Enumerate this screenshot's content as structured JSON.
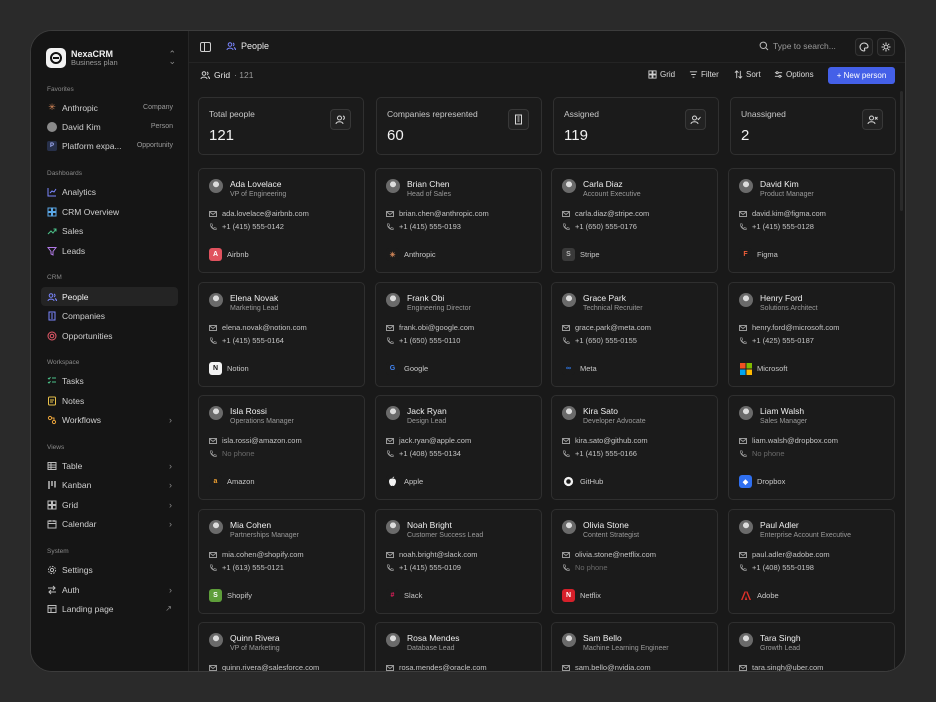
{
  "workspace": {
    "name": "NexaCRM",
    "plan": "Business plan"
  },
  "sidebar": {
    "favorites": {
      "label": "Favorites",
      "items": [
        {
          "label": "Anthropic",
          "meta": "Company"
        },
        {
          "label": "David Kim",
          "meta": "Person"
        },
        {
          "label": "Platform expa...",
          "meta": "Opportunity"
        }
      ]
    },
    "dashboards": {
      "label": "Dashboards",
      "items": [
        "Analytics",
        "CRM Overview",
        "Sales",
        "Leads"
      ]
    },
    "crm": {
      "label": "CRM",
      "items": [
        "People",
        "Companies",
        "Opportunities"
      ]
    },
    "workspace": {
      "label": "Workspace",
      "items": [
        "Tasks",
        "Notes",
        "Workflows"
      ]
    },
    "views": {
      "label": "Views",
      "items": [
        "Table",
        "Kanban",
        "Grid",
        "Calendar"
      ]
    },
    "system": {
      "label": "System",
      "items": [
        "Settings",
        "Auth",
        "Landing page"
      ]
    }
  },
  "topbar": {
    "breadcrumb": "People",
    "search_placeholder": "Type to search..."
  },
  "toolbar": {
    "view": "Grid",
    "count": "· 121",
    "grid": "Grid",
    "filter": "Filter",
    "sort": "Sort",
    "options": "Options",
    "new_person": "+ New person"
  },
  "stats": [
    {
      "label": "Total people",
      "value": "121",
      "icon": "users-icon"
    },
    {
      "label": "Companies represented",
      "value": "60",
      "icon": "building-icon"
    },
    {
      "label": "Assigned",
      "value": "119",
      "icon": "user-check-icon"
    },
    {
      "label": "Unassigned",
      "value": "2",
      "icon": "user-x-icon"
    }
  ],
  "people": [
    {
      "name": "Ada Lovelace",
      "role": "VP of Engineering",
      "email": "ada.lovelace@airbnb.com",
      "phone": "+1 (415) 555-0142",
      "company": "Airbnb",
      "logo_color": "#e0525e",
      "logo_glyph": "A"
    },
    {
      "name": "Brian Chen",
      "role": "Head of Sales",
      "email": "brian.chen@anthropic.com",
      "phone": "+1 (415) 555-0193",
      "company": "Anthropic",
      "logo_color": "#1b1b1b",
      "logo_glyph": "✳"
    },
    {
      "name": "Carla Diaz",
      "role": "Account Executive",
      "email": "carla.diaz@stripe.com",
      "phone": "+1 (650) 555-0176",
      "company": "Stripe",
      "logo_color": "#3a3a3a",
      "logo_glyph": "S"
    },
    {
      "name": "David Kim",
      "role": "Product Manager",
      "email": "david.kim@figma.com",
      "phone": "+1 (415) 555-0128",
      "company": "Figma",
      "logo_color": "#1b1b1b",
      "logo_glyph": "F"
    },
    {
      "name": "Elena Novak",
      "role": "Marketing Lead",
      "email": "elena.novak@notion.com",
      "phone": "+1 (415) 555-0164",
      "company": "Notion",
      "logo_color": "#f2f2f2",
      "logo_glyph": "N"
    },
    {
      "name": "Frank Obi",
      "role": "Engineering Director",
      "email": "frank.obi@google.com",
      "phone": "+1 (650) 555-0110",
      "company": "Google",
      "logo_color": "#1b1b1b",
      "logo_glyph": "G"
    },
    {
      "name": "Grace Park",
      "role": "Technical Recruiter",
      "email": "grace.park@meta.com",
      "phone": "+1 (650) 555-0155",
      "company": "Meta",
      "logo_color": "#1b1b1b",
      "logo_glyph": "∞"
    },
    {
      "name": "Henry Ford",
      "role": "Solutions Architect",
      "email": "henry.ford@microsoft.com",
      "phone": "+1 (425) 555-0187",
      "company": "Microsoft",
      "logo_color": "#1b1b1b",
      "logo_glyph": ""
    },
    {
      "name": "Isla Rossi",
      "role": "Operations Manager",
      "email": "isla.rossi@amazon.com",
      "phone": "No phone",
      "company": "Amazon",
      "logo_color": "#1b1b1b",
      "logo_glyph": "a"
    },
    {
      "name": "Jack Ryan",
      "role": "Design Lead",
      "email": "jack.ryan@apple.com",
      "phone": "+1 (408) 555-0134",
      "company": "Apple",
      "logo_color": "#1b1b1b",
      "logo_glyph": ""
    },
    {
      "name": "Kira Sato",
      "role": "Developer Advocate",
      "email": "kira.sato@github.com",
      "phone": "+1 (415) 555-0166",
      "company": "GitHub",
      "logo_color": "#1b1b1b",
      "logo_glyph": ""
    },
    {
      "name": "Liam Walsh",
      "role": "Sales Manager",
      "email": "liam.walsh@dropbox.com",
      "phone": "No phone",
      "company": "Dropbox",
      "logo_color": "#2f6ff0",
      "logo_glyph": "◆"
    },
    {
      "name": "Mia Cohen",
      "role": "Partnerships Manager",
      "email": "mia.cohen@shopify.com",
      "phone": "+1 (613) 555-0121",
      "company": "Shopify",
      "logo_color": "#5e9e3a",
      "logo_glyph": "S"
    },
    {
      "name": "Noah Bright",
      "role": "Customer Success Lead",
      "email": "noah.bright@slack.com",
      "phone": "+1 (415) 555-0109",
      "company": "Slack",
      "logo_color": "#1b1b1b",
      "logo_glyph": "#"
    },
    {
      "name": "Olivia Stone",
      "role": "Content Strategist",
      "email": "olivia.stone@netflix.com",
      "phone": "No phone",
      "company": "Netflix",
      "logo_color": "#d6202a",
      "logo_glyph": "N"
    },
    {
      "name": "Paul Adler",
      "role": "Enterprise Account Executive",
      "email": "paul.adler@adobe.com",
      "phone": "+1 (408) 555-0198",
      "company": "Adobe",
      "logo_color": "#1b1b1b",
      "logo_glyph": ""
    },
    {
      "name": "Quinn Rivera",
      "role": "VP of Marketing",
      "email": "quinn.rivera@salesforce.com",
      "phone": "",
      "company": "",
      "logo_color": "#1b1b1b",
      "logo_glyph": ""
    },
    {
      "name": "Rosa Mendes",
      "role": "Database Lead",
      "email": "rosa.mendes@oracle.com",
      "phone": "",
      "company": "",
      "logo_color": "#1b1b1b",
      "logo_glyph": ""
    },
    {
      "name": "Sam Bello",
      "role": "Machine Learning Engineer",
      "email": "sam.bello@nvidia.com",
      "phone": "",
      "company": "",
      "logo_color": "#1b1b1b",
      "logo_glyph": ""
    },
    {
      "name": "Tara Singh",
      "role": "Growth Lead",
      "email": "tara.singh@uber.com",
      "phone": "",
      "company": "",
      "logo_color": "#1b1b1b",
      "logo_glyph": ""
    }
  ],
  "colors": {
    "accent": "#4460e8",
    "bg": "#191919",
    "card": "#1b1b1b"
  }
}
